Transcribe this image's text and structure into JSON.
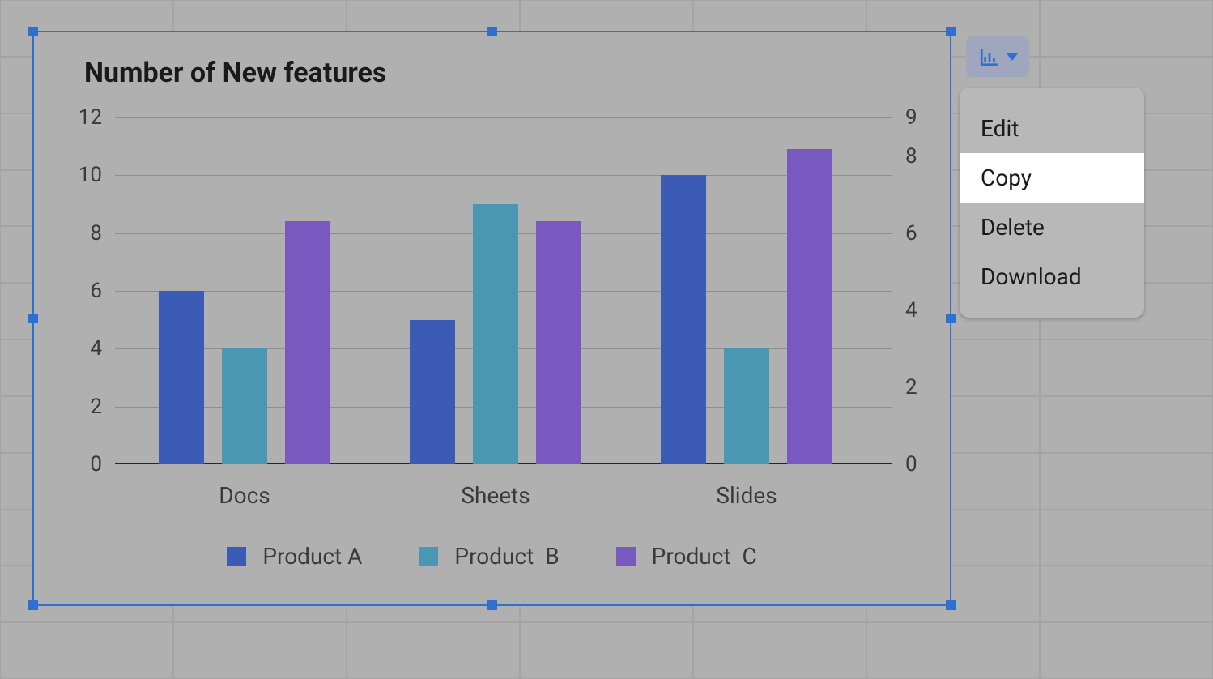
{
  "chart_data": {
    "type": "bar",
    "title": "Number of New features",
    "categories": [
      "Docs",
      "Sheets",
      "Slides"
    ],
    "series": [
      {
        "name": "Product A",
        "values": [
          6,
          5,
          10
        ],
        "color": "#3b5bb5"
      },
      {
        "name": "Product  B",
        "values": [
          4,
          9,
          4
        ],
        "color": "#4a97b3"
      },
      {
        "name": "Product  C",
        "values": [
          8.4,
          8.4,
          10.9
        ],
        "color": "#7859c0"
      }
    ],
    "left_axis": {
      "ticks": [
        0,
        2,
        4,
        6,
        8,
        10,
        12
      ],
      "min": 0,
      "max": 12
    },
    "right_axis": {
      "ticks": [
        0,
        2,
        4,
        6,
        8,
        9
      ],
      "min": 0,
      "max": 9
    }
  },
  "menu": {
    "icon_name": "chart-column-icon",
    "items": [
      "Edit",
      "Copy",
      "Delete",
      "Download"
    ],
    "highlighted_index": 1
  }
}
